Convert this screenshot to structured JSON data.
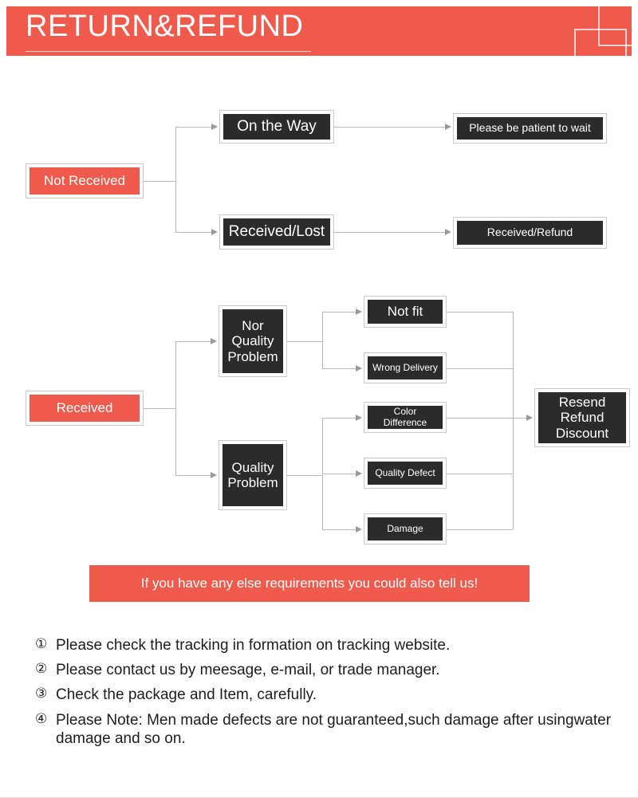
{
  "header": {
    "title": "RETURN&REFUND",
    "accent_color": "#ef5a4c"
  },
  "flow_not_received": {
    "root": {
      "label": "Not Received",
      "style": "red"
    },
    "stage2": [
      {
        "label": "On the Way",
        "style": "dark"
      },
      {
        "label": "Received/Lost",
        "style": "dark"
      }
    ],
    "stage3": [
      {
        "label": "Please be patient to wait",
        "style": "dark"
      },
      {
        "label": "Received/Refund",
        "style": "dark"
      }
    ]
  },
  "flow_received": {
    "root": {
      "label": "Received",
      "style": "red"
    },
    "categories": [
      {
        "label": "Nor\nQuality\nProblem",
        "style": "dark"
      },
      {
        "label": "Quality\nProblem",
        "style": "dark"
      }
    ],
    "reasons": [
      {
        "label": "Not fit",
        "style": "dark"
      },
      {
        "label": "Wrong Delivery",
        "style": "dark"
      },
      {
        "label": "Color Difference",
        "style": "dark"
      },
      {
        "label": "Quality Defect",
        "style": "dark"
      },
      {
        "label": "Damage",
        "style": "dark"
      }
    ],
    "outcome": {
      "label": "Resend\nRefund\nDiscount",
      "style": "dark"
    }
  },
  "callout": {
    "text": "If you have any else requirements you could also tell us!"
  },
  "notes": [
    {
      "number": "①",
      "text": "Please check the tracking in formation on tracking website."
    },
    {
      "number": "②",
      "text": "Please contact us by meesage, e-mail, or trade manager."
    },
    {
      "number": "③",
      "text": "Check the package and Item, carefully."
    },
    {
      "number": "④",
      "text": "Please Note: Men made defects are not guaranteed,such damage after usingwater damage and so on."
    }
  ]
}
